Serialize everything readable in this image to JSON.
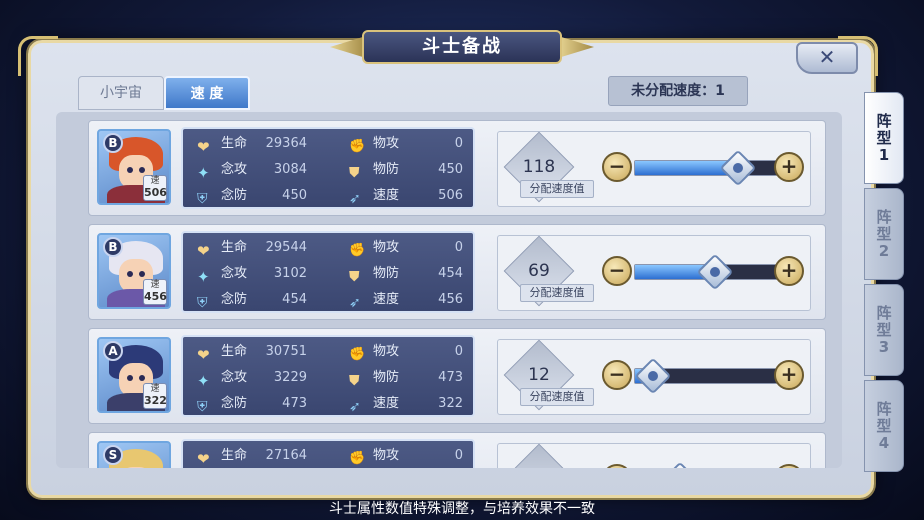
{
  "title": "斗士备战",
  "close_label": "✕",
  "tabs": [
    {
      "label": "小宇宙",
      "active": false
    },
    {
      "label": "速 度",
      "active": true
    }
  ],
  "unassigned_label": "未分配速度：1",
  "stat_labels": {
    "hp": "生命",
    "mental_attack": "念攻",
    "mental_defense": "念防",
    "physical_attack": "物攻",
    "physical_defense": "物防",
    "speed": "速度"
  },
  "alloc_label": "分配速度值",
  "speed_tag_label": "速",
  "minus_label": "−",
  "plus_label": "+",
  "fighters": [
    {
      "grade": "B",
      "tag_speed": "506",
      "hp": "29364",
      "mental_attack": "3084",
      "mental_defense": "450",
      "physical_attack": "0",
      "physical_defense": "450",
      "speed": "506",
      "alloc": "118",
      "slider_fraction": 0.69,
      "hair_color": "#d8562a",
      "body_color": "#8b2f3a"
    },
    {
      "grade": "B",
      "tag_speed": "456",
      "hp": "29544",
      "mental_attack": "3102",
      "mental_defense": "454",
      "physical_attack": "0",
      "physical_defense": "454",
      "speed": "456",
      "alloc": "69",
      "slider_fraction": 0.53,
      "hair_color": "#e6e6f2",
      "body_color": "#6b58a8"
    },
    {
      "grade": "A",
      "tag_speed": "322",
      "hp": "30751",
      "mental_attack": "3229",
      "mental_defense": "473",
      "physical_attack": "0",
      "physical_defense": "473",
      "speed": "322",
      "alloc": "12",
      "slider_fraction": 0.12,
      "hair_color": "#2c3a78",
      "body_color": "#3b3f6a"
    },
    {
      "grade": "S",
      "tag_speed": "",
      "hp": "27164",
      "mental_attack": "",
      "mental_defense": "",
      "physical_attack": "0",
      "physical_defense": "",
      "speed": "",
      "alloc": "",
      "slider_fraction": 0.3,
      "hair_color": "#e8c770",
      "body_color": "#8a6a2a"
    }
  ],
  "side_tabs": [
    {
      "label": "阵\n型\n1",
      "active": true
    },
    {
      "label": "阵\n型\n2",
      "active": false
    },
    {
      "label": "阵\n型\n3",
      "active": false
    },
    {
      "label": "阵\n型\n4",
      "active": false
    }
  ],
  "footer_note": "斗士属性数值特殊调整，与培养效果不一致"
}
